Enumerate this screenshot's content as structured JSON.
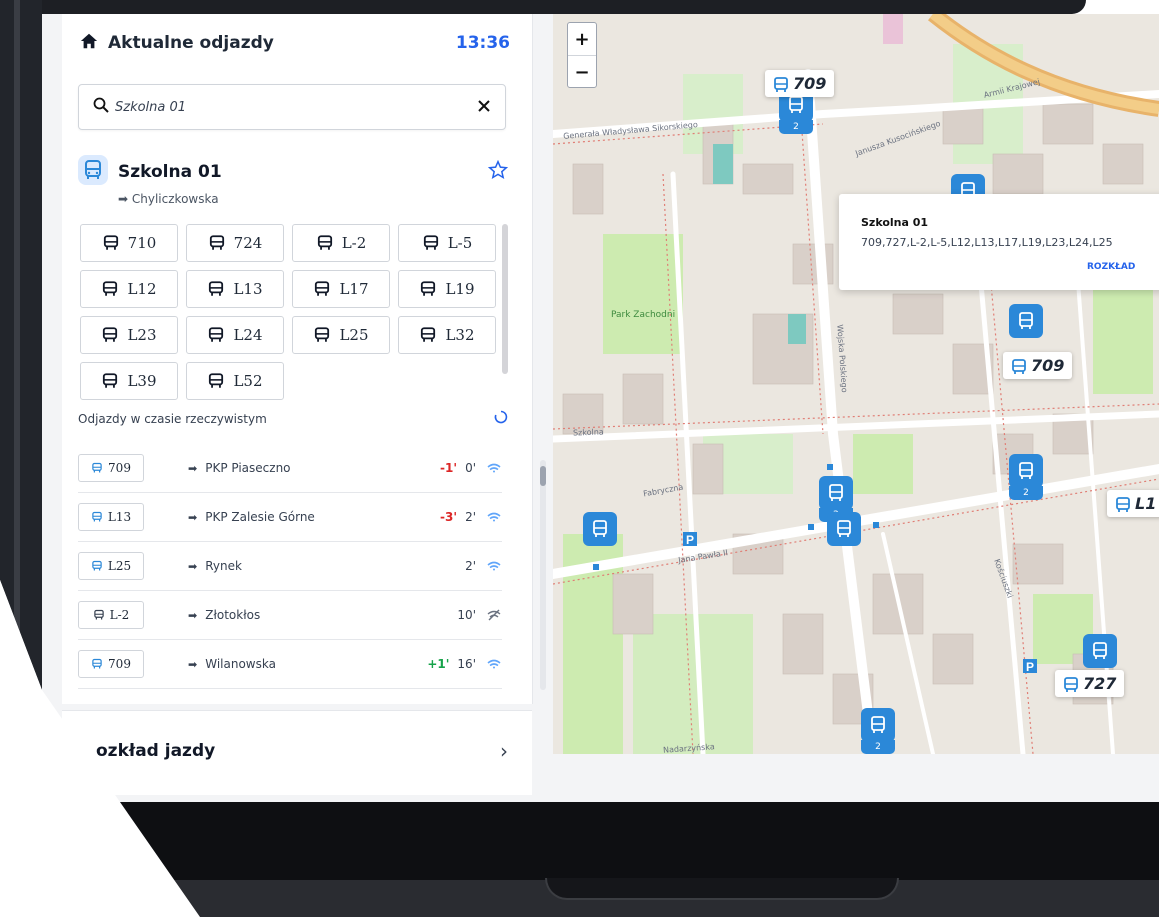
{
  "header": {
    "title": "Aktualne odjazdy",
    "time": "13:36"
  },
  "search": {
    "value": "Szkolna 01"
  },
  "stop": {
    "name": "Szkolna 01",
    "direction": "Chyliczkowska"
  },
  "lines": [
    "710",
    "724",
    "L-2",
    "L-5",
    "L12",
    "L13",
    "L17",
    "L19",
    "L23",
    "L24",
    "L25",
    "L32",
    "L39",
    "L52"
  ],
  "realtime_label": "Odjazdy w czasie rzeczywistym",
  "departures": [
    {
      "line": "709",
      "destination": "PKP Piaseczno",
      "delay": "-1'",
      "delay_type": "neg",
      "minutes": "0'",
      "realtime": true
    },
    {
      "line": "L13",
      "destination": "PKP Zalesie Górne",
      "delay": "-3'",
      "delay_type": "neg",
      "minutes": "2'",
      "realtime": true
    },
    {
      "line": "L25",
      "destination": "Rynek",
      "delay": "",
      "delay_type": "",
      "minutes": "2'",
      "realtime": true
    },
    {
      "line": "L-2",
      "destination": "Złotokłos",
      "delay": "",
      "delay_type": "",
      "minutes": "10'",
      "realtime": false
    },
    {
      "line": "709",
      "destination": "Wilanowska",
      "delay": "+1'",
      "delay_type": "pos",
      "minutes": "16'",
      "realtime": true
    }
  ],
  "timetable_label": "ozkład jazdy",
  "map": {
    "zoom_in": "+",
    "zoom_out": "−",
    "popup": {
      "title": "Szkolna 01",
      "lines": "709,727,L-2,L-5,L12,L13,L17,L19,L23,L24,L25",
      "link": "ROZKŁAD"
    },
    "labels": {
      "top": "709",
      "mid": "709",
      "right": "L1",
      "bottom": "727"
    },
    "marker_sub": "2",
    "streets": {
      "s1": "Armii Krajowej",
      "s2": "Generała Władysława Sikorskiego",
      "s3": "Janusza Kusocińskiego",
      "s4": "Szkolna",
      "s5": "Fabryczna",
      "s6": "Jana Pawła II",
      "s7": "Wojska Polskiego",
      "s8": "Park Zachodni",
      "s9": "Nadarzyńska",
      "s10": "Kościuszki"
    }
  },
  "colors": {
    "accent": "#2563eb",
    "marker": "#2b88d8",
    "late": "#dc2626",
    "early": "#16a34a"
  }
}
